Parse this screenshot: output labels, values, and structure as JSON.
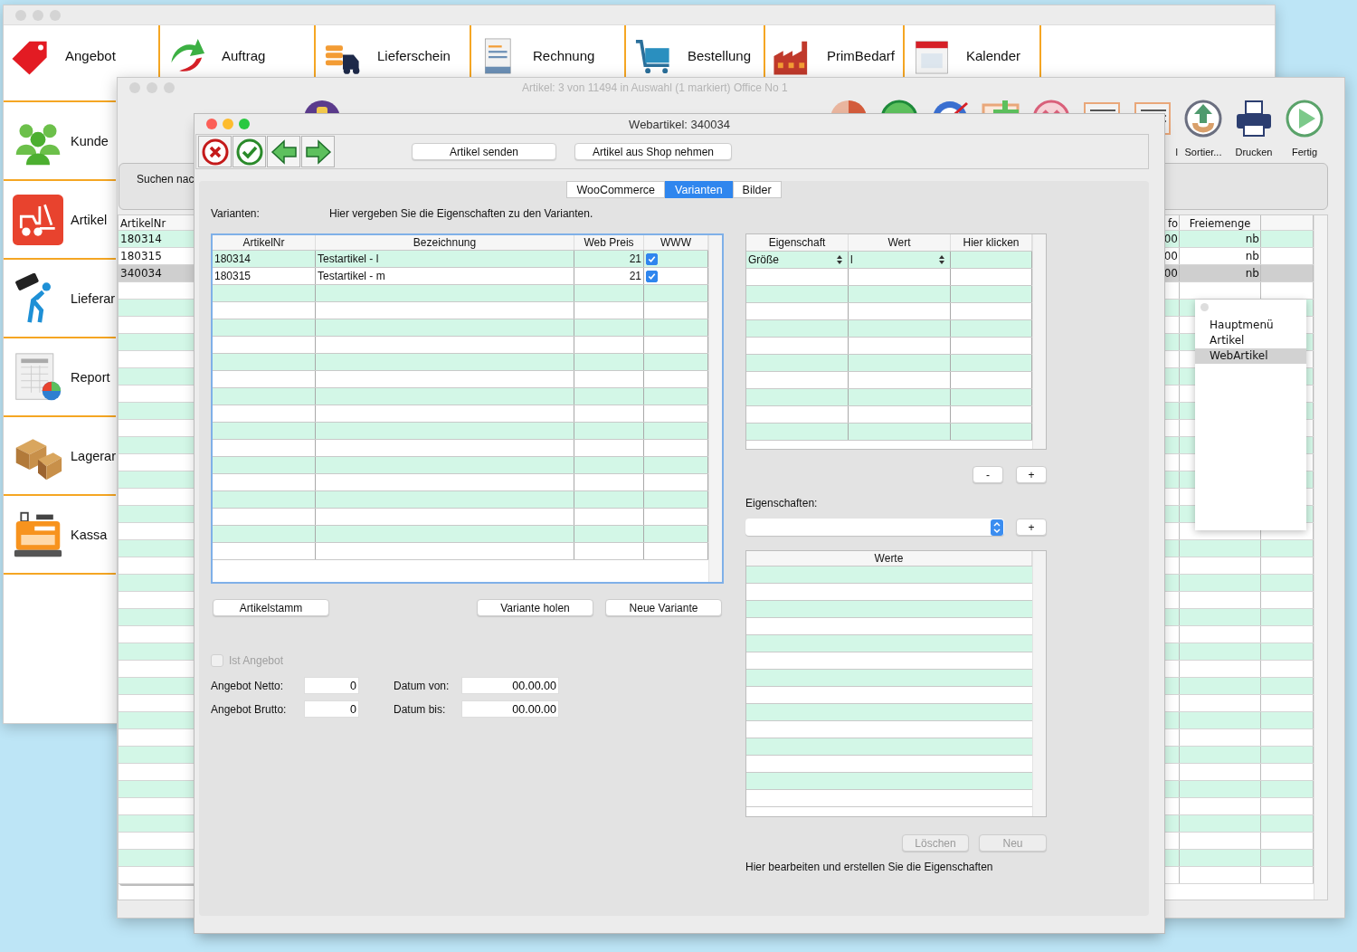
{
  "back_window": {
    "modules": [
      "Angebot",
      "Auftrag",
      "Lieferschein",
      "Rechnung",
      "Bestellung",
      "PrimBedarf",
      "Kalender"
    ],
    "sidebar": [
      "Kunde",
      "Artikel",
      "Lieferar",
      "Report",
      "Lagerar",
      "Kassa"
    ]
  },
  "list_window": {
    "title": "Artikel: 3 von 11494 in Auswahl  (1 markiert) Office No 1",
    "toolbar_labels": [
      "l",
      "Sortier...",
      "Drucken",
      "Fertig"
    ],
    "search_label": "Suchen nac",
    "table": {
      "columns": [
        "ArtikelNr",
        "fo",
        "Freiemenge"
      ],
      "rows": [
        {
          "cells": [
            "180314",
            "00",
            "nb"
          ],
          "selected": false
        },
        {
          "cells": [
            "180315",
            "00",
            "nb"
          ],
          "selected": false
        },
        {
          "cells": [
            "340034",
            "00",
            "nb"
          ],
          "selected": true
        }
      ]
    },
    "popup": {
      "items": [
        {
          "label": "Hauptmenü",
          "selected": false
        },
        {
          "label": "Artikel",
          "selected": false
        },
        {
          "label": "WebArtikel",
          "selected": true
        }
      ]
    }
  },
  "dialog": {
    "title": "Webartikel: 340034",
    "buttons": [
      "Artikel senden",
      "Artikel aus Shop nehmen"
    ],
    "tabs": [
      {
        "label": "WooCommerce",
        "selected": false
      },
      {
        "label": "Varianten",
        "selected": true
      },
      {
        "label": "Bilder",
        "selected": false
      }
    ],
    "variants_label": "Varianten:",
    "variants_hint": "Hier vergeben Sie die Eigenschaften zu den Varianten.",
    "variants_table": {
      "columns": [
        "ArtikelNr",
        "Bezeichnung",
        "Web Preis",
        "WWW"
      ],
      "rows": [
        {
          "nr": "180314",
          "name": "Testartikel - l",
          "price": "21",
          "www": true
        },
        {
          "nr": "180315",
          "name": "Testartikel - m",
          "price": "21",
          "www": true
        }
      ]
    },
    "variant_buttons": [
      "Artikelstamm",
      "Variante holen",
      "Neue Variante"
    ],
    "offer": {
      "label": "Ist Angebot",
      "checked": false,
      "disabled": true
    },
    "price_fields": [
      {
        "label": "Angebot Netto:",
        "value": "0"
      },
      {
        "label": "Angebot Brutto:",
        "value": "0"
      }
    ],
    "date_fields": [
      {
        "label": "Datum von:",
        "value": "00.00.00"
      },
      {
        "label": "Datum bis:",
        "value": "00.00.00"
      }
    ],
    "properties_table": {
      "columns": [
        "Eigenschaft",
        "Wert",
        "Hier klicken"
      ],
      "rows": [
        {
          "property": "Größe",
          "value": "l"
        }
      ]
    },
    "row_buttons": [
      "-",
      "+"
    ],
    "properties_label": "Eigenschaften:",
    "add_button": "+",
    "values_table": {
      "columns": [
        "Werte"
      ]
    },
    "value_buttons": [
      {
        "label": "Löschen",
        "disabled": true
      },
      {
        "label": "Neu",
        "disabled": true
      }
    ],
    "footer_hint": "Hier bearbeiten und erstellen Sie die Eigenschaften"
  }
}
